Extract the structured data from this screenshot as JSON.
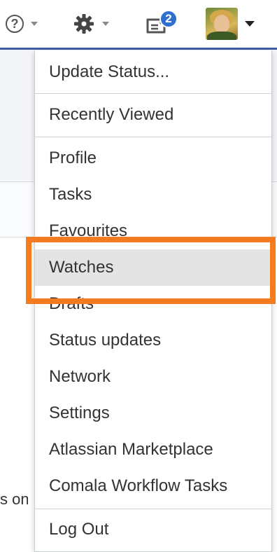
{
  "topbar": {
    "help_icon": "help-circle-icon",
    "help_glyph": "?",
    "settings_icon": "gear-icon",
    "notifications_icon": "tasks-notification-icon",
    "notification_count": "2",
    "avatar_icon": "user-avatar",
    "caret_icon": "chevron-down-icon"
  },
  "menu": {
    "items": [
      {
        "label": "Update Status..."
      },
      {
        "label": "Recently Viewed"
      },
      {
        "label": "Profile"
      },
      {
        "label": "Tasks"
      },
      {
        "label": "Favourites"
      },
      {
        "label": "Watches",
        "active": true
      },
      {
        "label": "Drafts"
      },
      {
        "label": "Status updates"
      },
      {
        "label": "Network"
      },
      {
        "label": "Settings"
      },
      {
        "label": "Atlassian Marketplace"
      },
      {
        "label": "Comala Workflow Tasks"
      },
      {
        "label": "Log Out"
      }
    ]
  },
  "background": {
    "partial_text": "s on"
  },
  "colors": {
    "highlight": "#f47b20",
    "badge": "#2f6fd0",
    "active_item": "#e4e4e4"
  }
}
